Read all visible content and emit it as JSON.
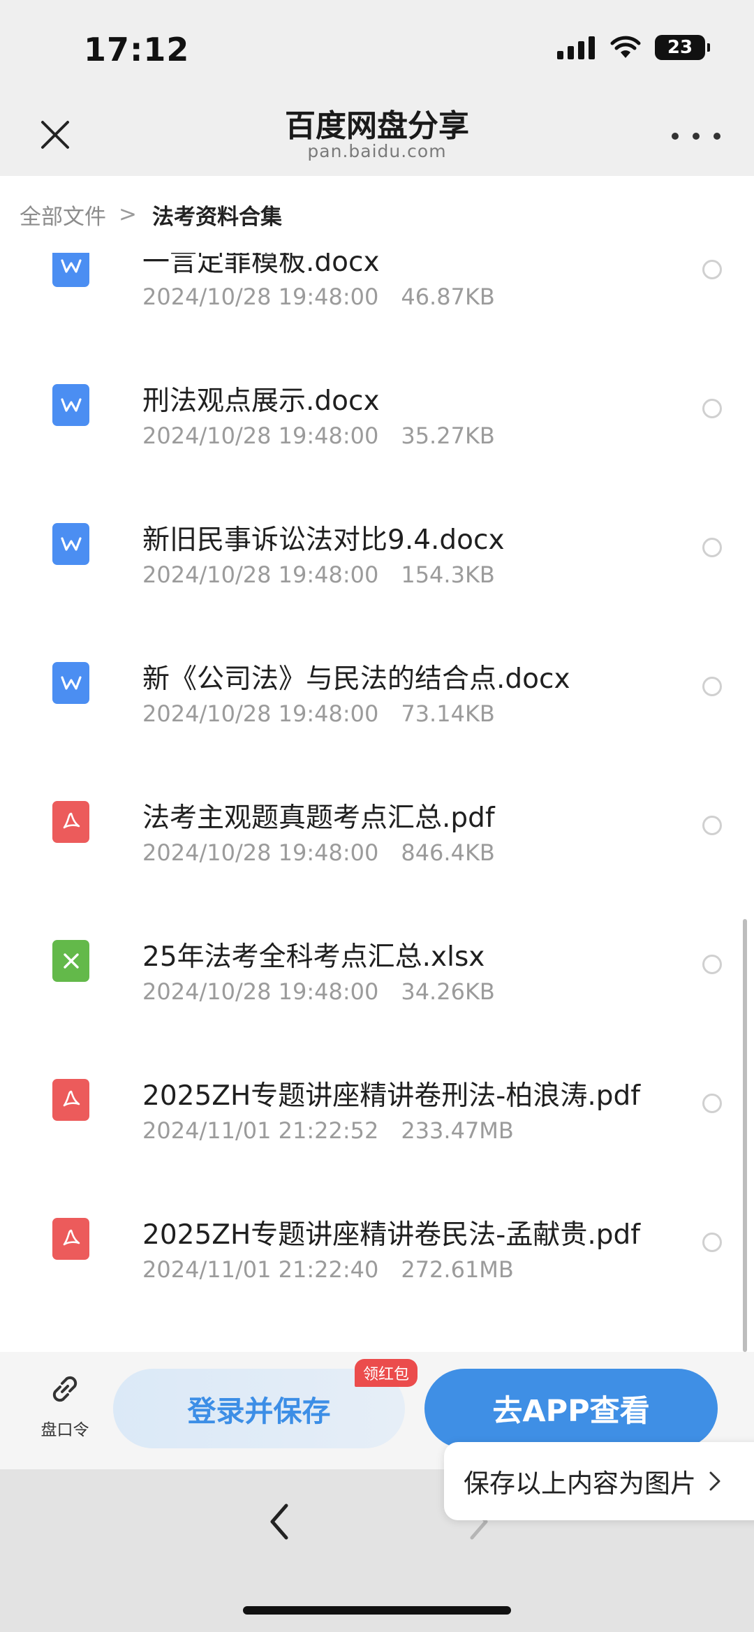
{
  "status": {
    "time": "17:12",
    "battery": "23"
  },
  "nav": {
    "title": "百度网盘分享",
    "subtitle": "pan.baidu.com"
  },
  "breadcrumb": {
    "root": "全部文件",
    "separator": ">",
    "current": "法考资料合集"
  },
  "files": [
    {
      "name": "一言定罪模板.docx",
      "date": "2024/10/28 19:48:00",
      "size": "46.87KB",
      "type": "doc"
    },
    {
      "name": "刑法观点展示.docx",
      "date": "2024/10/28 19:48:00",
      "size": "35.27KB",
      "type": "doc"
    },
    {
      "name": "新旧民事诉讼法对比9.4.docx",
      "date": "2024/10/28 19:48:00",
      "size": "154.3KB",
      "type": "doc"
    },
    {
      "name": "新《公司法》与民法的结合点.docx",
      "date": "2024/10/28 19:48:00",
      "size": "73.14KB",
      "type": "doc"
    },
    {
      "name": "法考主观题真题考点汇总.pdf",
      "date": "2024/10/28 19:48:00",
      "size": "846.4KB",
      "type": "pdf"
    },
    {
      "name": "25年法考全科考点汇总.xlsx",
      "date": "2024/10/28 19:48:00",
      "size": "34.26KB",
      "type": "xls"
    },
    {
      "name": "2025ZH专题讲座精讲卷刑法-柏浪涛.pdf",
      "date": "2024/11/01 21:22:52",
      "size": "233.47MB",
      "type": "pdf"
    },
    {
      "name": "2025ZH专题讲座精讲卷民法-孟献贵.pdf",
      "date": "2024/11/01 21:22:40",
      "size": "272.61MB",
      "type": "pdf"
    }
  ],
  "actions": {
    "pancode_label": "盘口令",
    "login_save": "登录并保存",
    "red_badge": "领红包",
    "go_app": "去APP查看"
  },
  "popup": {
    "save_as_image": "保存以上内容为图片"
  },
  "colors": {
    "accent": "#3f8fe5",
    "doc": "#4b8ef2",
    "pdf": "#ec5b5b",
    "xls": "#63b94a",
    "badge": "#eb4c4c"
  }
}
